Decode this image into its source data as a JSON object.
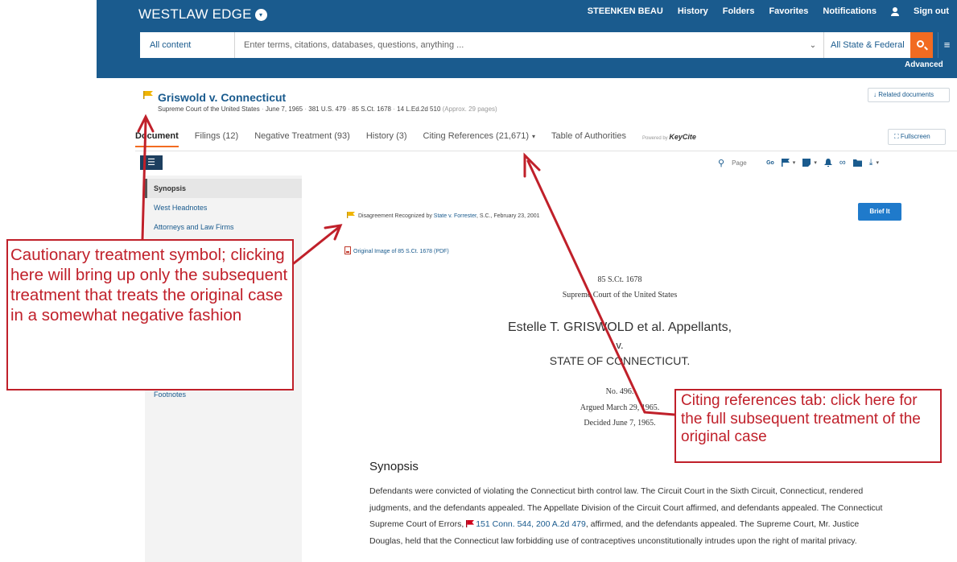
{
  "header": {
    "brand": "WESTLAW EDGE",
    "brand_caret": "▾",
    "nav": {
      "user_name": "STEENKEN BEAU",
      "history": "History",
      "folders": "Folders",
      "favorites": "Favorites",
      "notifications": "Notifications",
      "sign_out": "Sign out"
    },
    "search": {
      "scope": "All content",
      "placeholder": "Enter terms, citations, databases, questions, anything ...",
      "chevron": "⌄",
      "jurisdiction": "All State & Federal",
      "menu_glyph": "≡",
      "advanced": "Advanced"
    }
  },
  "document": {
    "title": "Griswold v. Connecticut",
    "court": "Supreme Court of the United States",
    "date": "June 7, 1965",
    "cite_us": "381 U.S. 479",
    "cite_sct": "85 S.Ct. 1678",
    "cite_led": "14 L.Ed.2d 510",
    "pages": "(Approx. 29 pages)",
    "related_documents": "Related documents",
    "related_icon": "↓",
    "flag_color": "#f0b400"
  },
  "tabs": [
    {
      "label": "Document"
    },
    {
      "label": "Filings (12)"
    },
    {
      "label": "Negative Treatment (93)"
    },
    {
      "label": "History (3)"
    },
    {
      "label": "Citing References (21,671)",
      "caret": "▾"
    },
    {
      "label": "Table of Authorities"
    }
  ],
  "keycite": {
    "powered_by": "Powered by",
    "brand": "KeyCite"
  },
  "fullscreen": {
    "icon": "⛶",
    "label": "Fullscreen"
  },
  "toc_toggle": "☰",
  "toolbar": {
    "page_placeholder": "Page",
    "go": "Go",
    "caret": "▾",
    "link_glyph": "∞",
    "download_glyph": "⤓"
  },
  "toc": [
    {
      "label": "Synopsis"
    },
    {
      "label": "West Headnotes"
    },
    {
      "label": "Attorneys and Law Firms"
    },
    {
      "label": "Footnotes"
    }
  ],
  "treatment": {
    "prefix": "Disagreement Recognized by",
    "case": "State v. Forrester",
    "suffix": ", S.C., February 23, 2001"
  },
  "brief_it": "Brief It",
  "pdf_link": "Original Image of 85 S.Ct. 1678 (PDF)",
  "caption": {
    "cite": "85 S.Ct. 1678",
    "court": "Supreme Court of the United States",
    "parties_1": "Estelle T. GRISWOLD et al. Appellants,",
    "v": "v.",
    "parties_2": "STATE OF CONNECTICUT.",
    "docket": "No. 496.",
    "argued": "Argued March 29, 1965.",
    "decided": "Decided June 7, 1965."
  },
  "synopsis": {
    "heading": "Synopsis",
    "text_1": "Defendants were convicted of violating the Connecticut birth control law. The Circuit Court in the Sixth Circuit, Connecticut, rendered judgments, and the defendants appealed. The Appellate Division of the Circuit Court affirmed, and defendants appealed. The Connecticut Supreme Court of Errors, ",
    "citation": "151 Conn. 544, 200 A.2d 479",
    "text_2": ", affirmed, and the defendants appealed. The Supreme Court, Mr. Justice Douglas, held that the Connecticut law forbidding use of contraceptives unconstitutionally intrudes upon the right of marital privacy.",
    "red_flag_color": "#d0021b"
  },
  "annotations": {
    "left_callout": "Cautionary treatment symbol; clicking here will bring up only the subsequent treatment that treats the original case in a somewhat negative fashion",
    "right_callout": "Citing references tab: click here for the full subsequent treatment of the original case",
    "color": "#c0202a"
  }
}
